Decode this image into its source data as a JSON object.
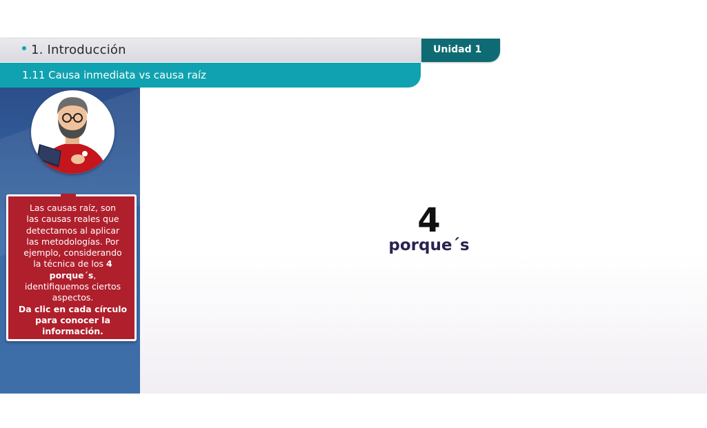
{
  "header": {
    "section_title": "1. Introducción",
    "unit_label": "Unidad 1"
  },
  "subheader": {
    "title": "1.11 Causa inmediata vs causa raíz"
  },
  "sidebar": {
    "avatar_icon": "teacher-avatar",
    "bubble": {
      "line1": "Las causas raíz, son",
      "line2": "las causas reales que",
      "line3": "detectamos al aplicar",
      "line4": "las metodologías. Por",
      "line5": "ejemplo, considerando",
      "line6a": "la técnica de los ",
      "line6b": "4",
      "line7a": "porque´s",
      "line7b": ",",
      "line8": "identifiquemos ciertos",
      "line9": "aspectos.",
      "cta1": "Da clic en cada círculo",
      "cta2": "para conocer la",
      "cta3": "información."
    }
  },
  "main": {
    "number": "4",
    "label": "porque´s"
  },
  "colors": {
    "teal": "#10a2b0",
    "dark_teal": "#0e6b73",
    "sidebar_blue": "#3b6aa6",
    "bubble_red": "#b01f2c",
    "label_navy": "#2a2350"
  }
}
